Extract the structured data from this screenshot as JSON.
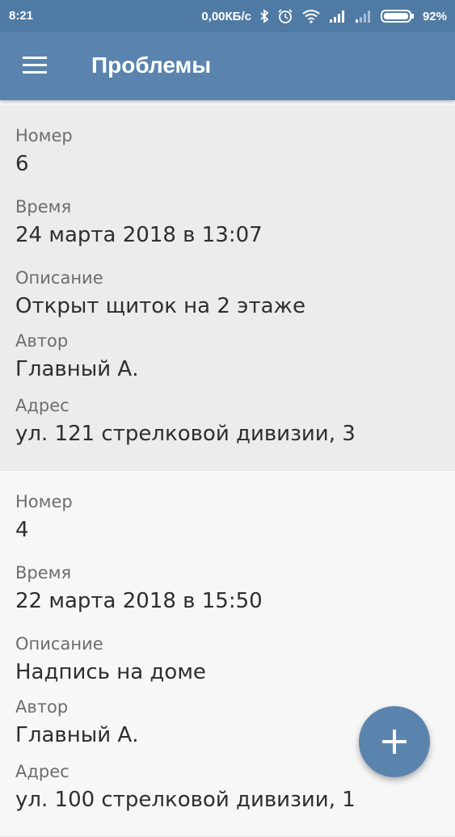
{
  "status_bar": {
    "time": "8:21",
    "network_speed": "0,00КБ/с",
    "battery": "92%",
    "icons": [
      "bluetooth-icon",
      "alarm-icon",
      "wifi-icon",
      "signal-icon",
      "signal-weak-icon",
      "battery-icon"
    ]
  },
  "app_bar": {
    "title": "Проблемы",
    "menu_icon": "hamburger-menu-icon",
    "color": "#5a84ad"
  },
  "problems": [
    {
      "number_label": "Номер",
      "number": "6",
      "time_label": "Время",
      "time": "24 марта 2018 в 13:07",
      "description_label": "Описание",
      "description": "Открыт щиток на 2 этаже",
      "author_label": "Автор",
      "author": "Главный А.",
      "address_label": "Адрес",
      "address": "ул. 121 стрелковой дивизии, 3"
    },
    {
      "number_label": "Номер",
      "number": "4",
      "time_label": "Время",
      "time": "22 марта 2018 в 15:50",
      "description_label": "Описание",
      "description": "Надпись на доме",
      "author_label": "Автор",
      "author": "Главный А.",
      "address_label": "Адрес",
      "address": "ул. 100 стрелковой дивизии, 1"
    }
  ],
  "fab": {
    "icon": "plus-icon"
  }
}
